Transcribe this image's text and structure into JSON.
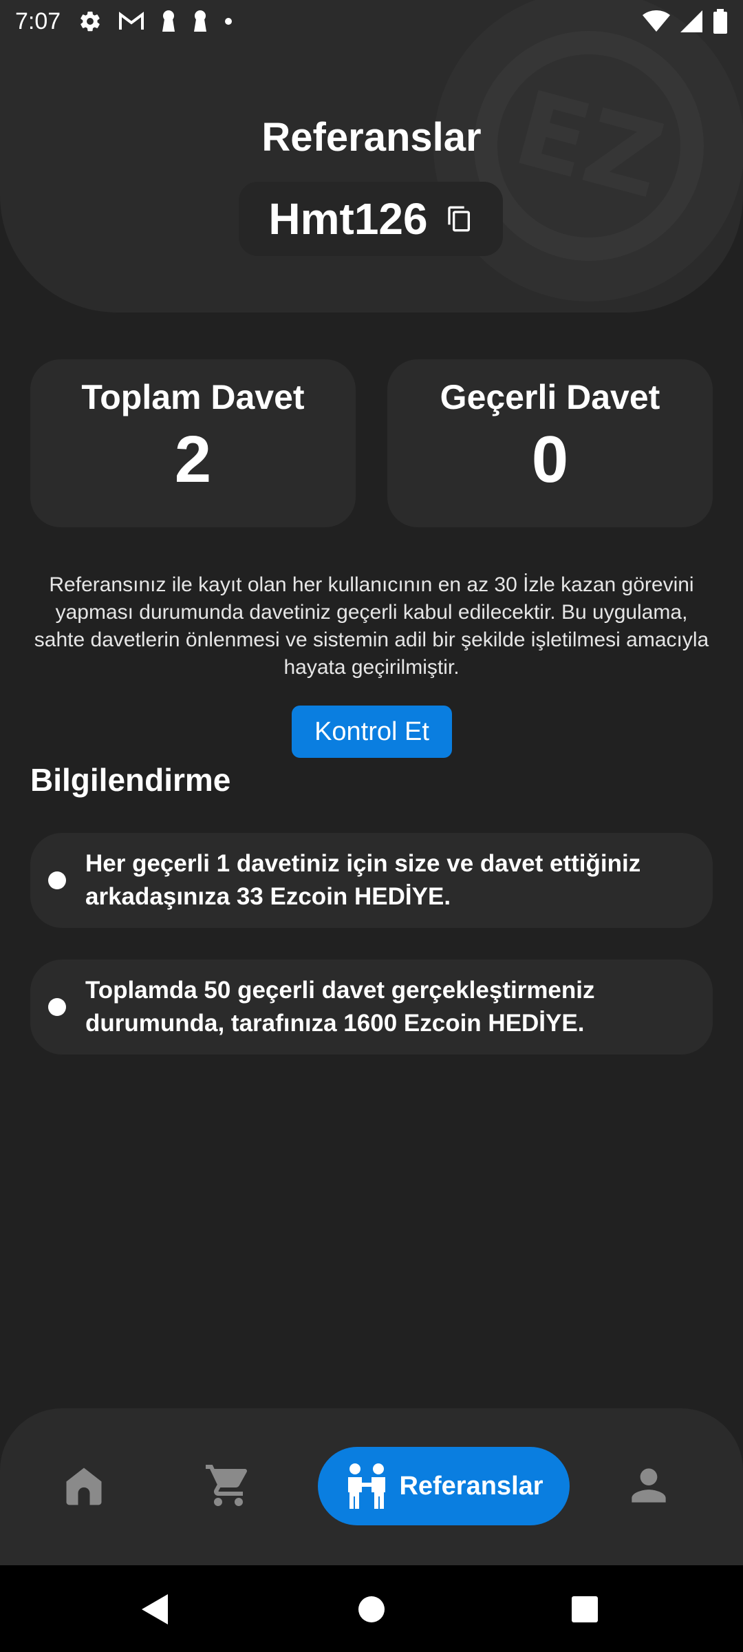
{
  "status_bar": {
    "time": "7:07",
    "icons": [
      "gear-icon",
      "gmail-icon",
      "keyhole-icon",
      "keyhole-icon",
      "dot-icon"
    ],
    "right_icons": [
      "wifi-icon",
      "signal-icon",
      "battery-icon"
    ]
  },
  "header": {
    "title": "Referanslar",
    "referral_code": "Hmt126",
    "copy_icon": "copy-icon",
    "watermark_text": "EZ"
  },
  "stats": {
    "total_label": "Toplam Davet",
    "total_value": "2",
    "valid_label": "Geçerli Davet",
    "valid_value": "0"
  },
  "description": "Referansınız ile kayıt olan her kullanıcının en az 30 İzle kazan görevini yapması durumunda davetiniz geçerli kabul edilecektir. Bu uygulama, sahte davetlerin önlenmesi ve sistemin adil bir şekilde işletilmesi amacıyla hayata geçirilmiştir.",
  "check_button": "Kontrol Et",
  "info": {
    "title": "Bilgilendirme",
    "items": [
      "Her geçerli 1 davetiniz için size ve davet ettiğiniz arkadaşınıza 33 Ezcoin HEDİYE.",
      "Toplamda 50 geçerli davet gerçekleştirmeniz durumunda, tarafınıza 1600 Ezcoin HEDİYE."
    ]
  },
  "bottom_nav": {
    "items": [
      {
        "icon": "home-icon"
      },
      {
        "icon": "cart-icon"
      },
      {
        "icon": "referral-icon",
        "label": "Referanslar",
        "active": true
      },
      {
        "icon": "profile-icon"
      }
    ]
  },
  "system_nav": [
    "back-icon",
    "home-circle-icon",
    "recents-icon"
  ],
  "colors": {
    "background": "#212121",
    "card": "#2b2b2b",
    "accent": "#0a7ee0",
    "text": "#ffffff"
  }
}
